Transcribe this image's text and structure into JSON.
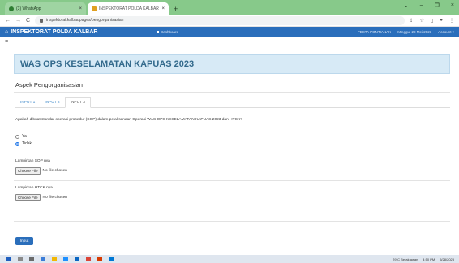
{
  "browser": {
    "tabs": [
      {
        "title": "(3) WhatsApp",
        "close": "×"
      },
      {
        "title": "INSPEKTORAT POLDA KALBAR",
        "close": "×"
      }
    ],
    "new_tab": "+",
    "window_controls": [
      "⌄",
      "–",
      "❐",
      "×"
    ],
    "url": "inspektorat.kalbar/pages/pengorganisasian",
    "back": "←",
    "forward": "→",
    "reload": "C",
    "share": "⇪",
    "star": "☆"
  },
  "navbar": {
    "brand": "INSPEKTORAT POLDA KALBAR",
    "home_icon": "home-icon",
    "dashboard": "Dashboard",
    "user": "PESTA PONTIANAK",
    "date": "Minggu, 28 Mei 2023",
    "account": "Account ▾"
  },
  "hamburger": "≡",
  "page": {
    "title": "WAS OPS KESELAMATAN KAPUAS 2023",
    "section": "Aspek Pengorganisasian",
    "tabs": [
      "INPUT 1",
      "INPUT 2",
      "INPUT 3"
    ],
    "active_tab": 2,
    "question": "Apakah dibuat standar operasi prosedur (SOP) dalam pelaksanaan Operasi WAS OPS KESELAMATAN KAPUAS 2023 dan HTCK?",
    "options": [
      {
        "label": "Ya",
        "checked": false
      },
      {
        "label": "Tidak",
        "checked": true
      }
    ],
    "uploads": [
      {
        "label": "Lampirkan SOP nya",
        "button": "Choose File",
        "status": "No file chosen"
      },
      {
        "label": "Lampirkan HTCK nya",
        "button": "Choose File",
        "status": "No file chosen"
      }
    ],
    "submit": "Input"
  },
  "colors": {
    "tab_strip": "#87c98a",
    "navbar": "#2a6ebb",
    "title_box": "#d7eaf6",
    "title_text": "#336a8c",
    "tab_link": "#3a86c8"
  },
  "taskbar": {
    "weather": "29°C Berak awan",
    "time": "4:50 PM",
    "date": "5/28/2023"
  }
}
